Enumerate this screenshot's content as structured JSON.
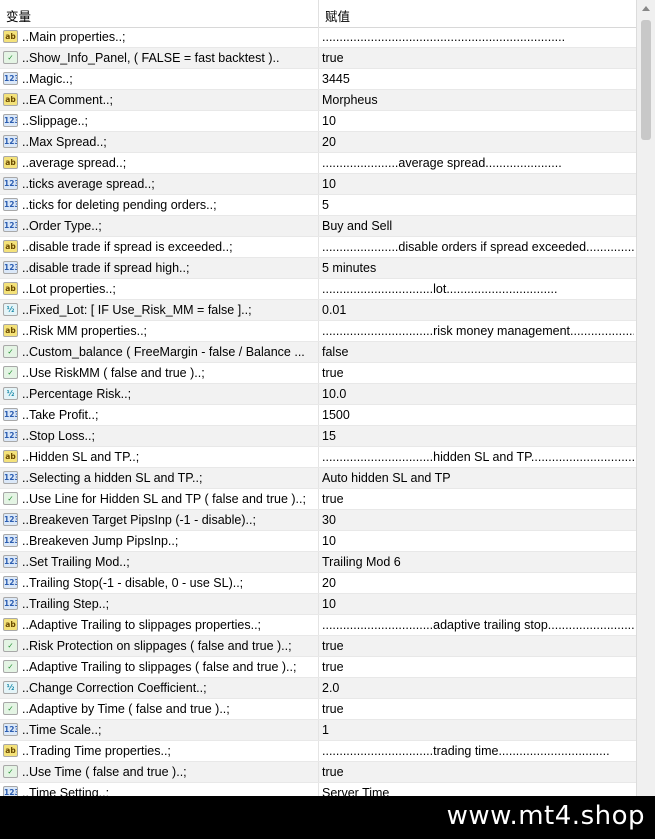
{
  "header": {
    "col_variable": "变量",
    "col_value": "赋值"
  },
  "rows": [
    {
      "icon": "ab",
      "name": "..Main properties..;",
      "value": "......................................................................"
    },
    {
      "icon": "bool",
      "name": "..Show_Info_Panel, ( FALSE = fast backtest )..",
      "value": "true"
    },
    {
      "icon": "123",
      "name": "..Magic..;",
      "value": "3445"
    },
    {
      "icon": "ab",
      "name": "..EA Comment..;",
      "value": "Morpheus"
    },
    {
      "icon": "123",
      "name": "..Slippage..;",
      "value": "10"
    },
    {
      "icon": "123",
      "name": "..Max Spread..;",
      "value": "20"
    },
    {
      "icon": "ab",
      "name": "..average spread..;",
      "value": "......................average spread......................"
    },
    {
      "icon": "123",
      "name": "..ticks average spread..;",
      "value": "10"
    },
    {
      "icon": "123",
      "name": "..ticks for deleting pending orders..;",
      "value": "5"
    },
    {
      "icon": "123",
      "name": "..Order Type..;",
      "value": "Buy and Sell"
    },
    {
      "icon": "ab",
      "name": "..disable trade if spread is exceeded..;",
      "value": "......................disable orders if spread exceeded................"
    },
    {
      "icon": "123",
      "name": "..disable trade if spread high..;",
      "value": "5 minutes"
    },
    {
      "icon": "ab",
      "name": "..Lot properties..;",
      "value": "................................lot................................"
    },
    {
      "icon": "dbl",
      "name": "..Fixed_Lot: [ IF  Use_Risk_MM = false ]..;",
      "value": "0.01"
    },
    {
      "icon": "ab",
      "name": "..Risk MM properties..;",
      "value": "................................risk money management.........................."
    },
    {
      "icon": "bool",
      "name": "..Custom_balance ( FreeMargin - false / Balance ...",
      "value": "false"
    },
    {
      "icon": "bool",
      "name": "..Use RiskMM ( false and true )..;",
      "value": "true"
    },
    {
      "icon": "dbl",
      "name": "..Percentage Risk..;",
      "value": "10.0"
    },
    {
      "icon": "123",
      "name": "..Take Profit..;",
      "value": "1500"
    },
    {
      "icon": "123",
      "name": "..Stop Loss..;",
      "value": "15"
    },
    {
      "icon": "ab",
      "name": "..Hidden SL and TP..;",
      "value": "................................hidden SL and TP................................"
    },
    {
      "icon": "123",
      "name": "..Selecting a hidden SL and TP..;",
      "value": "Auto hidden SL and TP"
    },
    {
      "icon": "bool",
      "name": "..Use Line for Hidden SL and TP ( false and true )..;",
      "value": "true"
    },
    {
      "icon": "123",
      "name": "..Breakeven Target PipsInp (-1 - disable)..;",
      "value": "30"
    },
    {
      "icon": "123",
      "name": "..Breakeven Jump PipsInp..;",
      "value": "10"
    },
    {
      "icon": "123",
      "name": "..Set Trailing Mod..;",
      "value": "Trailing Mod 6"
    },
    {
      "icon": "123",
      "name": "..Trailing Stop(-1 - disable, 0 - use SL)..;",
      "value": "20"
    },
    {
      "icon": "123",
      "name": "..Trailing Step..;",
      "value": "10"
    },
    {
      "icon": "ab",
      "name": "..Adaptive Trailing to slippages properties..;",
      "value": "................................adaptive trailing stop................................"
    },
    {
      "icon": "bool",
      "name": "..Risk Protection on slippages ( false and true )..;",
      "value": "true"
    },
    {
      "icon": "bool",
      "name": "..Adaptive Trailing to slippages ( false and true )..;",
      "value": "true"
    },
    {
      "icon": "dbl",
      "name": "..Change Correction Coefficient..;",
      "value": "2.0"
    },
    {
      "icon": "bool",
      "name": "..Adaptive by Time ( false and true )..;",
      "value": "true"
    },
    {
      "icon": "123",
      "name": "..Time Scale..;",
      "value": "1"
    },
    {
      "icon": "ab",
      "name": "..Trading Time properties..;",
      "value": "................................trading time................................"
    },
    {
      "icon": "bool",
      "name": "..Use Time ( false and true )..;",
      "value": "true"
    },
    {
      "icon": "123",
      "name": "..Time Setting..;",
      "value": "Server Time"
    }
  ],
  "watermark": "www.mt4.shop",
  "icon_names": {
    "ab": "string-type-icon",
    "123": "integer-type-icon",
    "bool": "bool-type-icon",
    "dbl": "double-type-icon"
  },
  "colors": {
    "string_icon": "#f4e27a",
    "integer_icon": "#dbe8f8",
    "bool_icon": "#e4f4e4",
    "double_icon": "#e4f4f8",
    "banner": "#000000"
  }
}
